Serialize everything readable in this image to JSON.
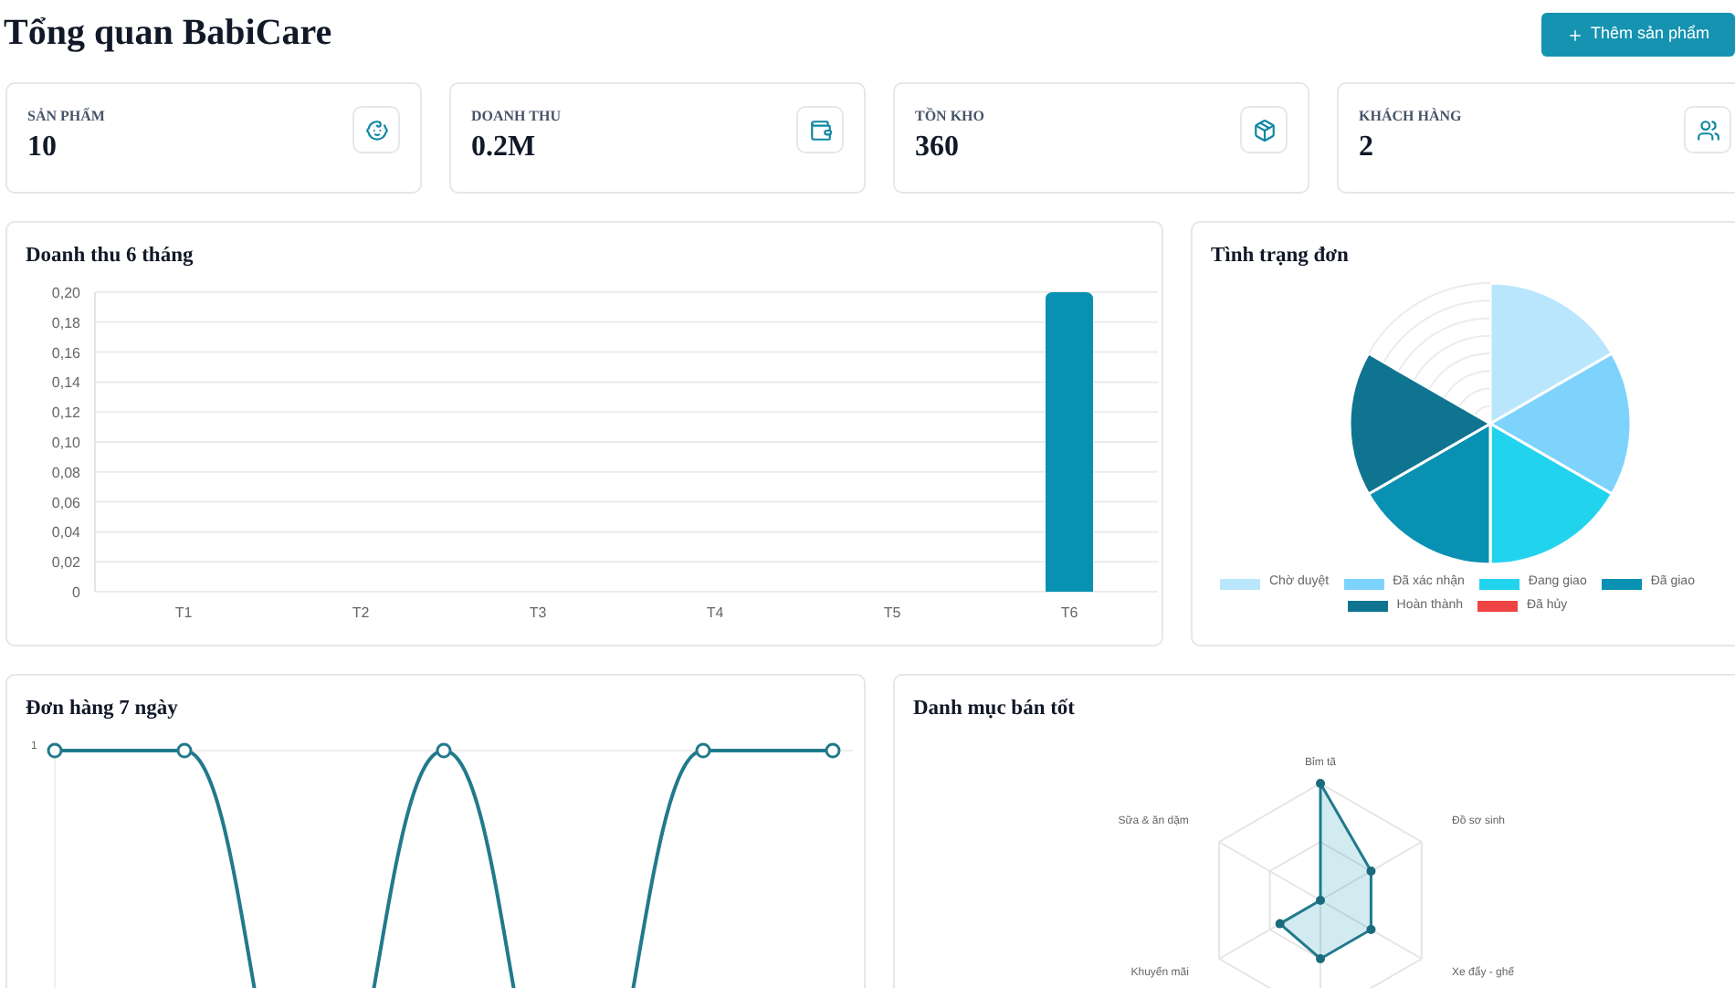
{
  "header": {
    "title": "Tổng quan BabiCare",
    "action_button": "Thêm sản phẩm"
  },
  "stats": [
    {
      "label": "SẢN PHẨM",
      "value": "10",
      "kind": "baby"
    },
    {
      "label": "DOANH THU",
      "value": "0.2M",
      "kind": "wallet"
    },
    {
      "label": "TỒN KHO",
      "value": "360",
      "kind": "box"
    },
    {
      "label": "KHÁCH HÀNG",
      "value": "2",
      "kind": "users"
    }
  ],
  "revenue_chart": {
    "title": "Doanh thu 6 tháng",
    "chart_data": {
      "type": "bar",
      "categories": [
        "T1",
        "T2",
        "T3",
        "T4",
        "T5",
        "T6"
      ],
      "series": [
        {
          "color": "#0891b2",
          "values": [
            0,
            0,
            0,
            0,
            0,
            0.2
          ]
        }
      ],
      "grid": true,
      "ylim": [
        0,
        0.2
      ],
      "yticks": [
        {
          "value": 0,
          "label": "0"
        },
        {
          "value": 0.02,
          "label": "0,02"
        },
        {
          "value": 0.04,
          "label": "0,04"
        },
        {
          "value": 0.06,
          "label": "0,06"
        },
        {
          "value": 0.08,
          "label": "0,08"
        },
        {
          "value": 0.1,
          "label": "0,10"
        },
        {
          "value": 0.12,
          "label": "0,12"
        },
        {
          "value": 0.14,
          "label": "0,14"
        },
        {
          "value": 0.16,
          "label": "0,16"
        },
        {
          "value": 0.18,
          "label": "0,18"
        },
        {
          "value": 0.2,
          "label": "0,20"
        }
      ]
    }
  },
  "order_status_chart": {
    "title": "Tình trạng đơn",
    "slices": [
      {
        "label": "Chờ duyệt",
        "color": "#bae6fd",
        "empty": false
      },
      {
        "label": "Đã xác nhận",
        "color": "#7dd3fc",
        "empty": false
      },
      {
        "label": "Đang giao",
        "color": "#22d3ee",
        "empty": false
      },
      {
        "label": "Đã giao",
        "color": "#0891b2",
        "empty": false
      },
      {
        "label": "Hoàn thành",
        "color": "#0e7490",
        "empty": false
      },
      {
        "label": "Đã hủy",
        "color": "#ef4444",
        "empty": true
      }
    ]
  },
  "orders_chart": {
    "title": "Đơn hàng 7 ngày",
    "y_tick": "1"
  },
  "category_chart": {
    "title": "Danh mục bán tốt",
    "axes": [
      "Bỉm tã",
      "Sữa & ăn dặm",
      "Đồ sơ sinh",
      "Khuyến mãi",
      "Xe đẩy - ghế"
    ]
  }
}
